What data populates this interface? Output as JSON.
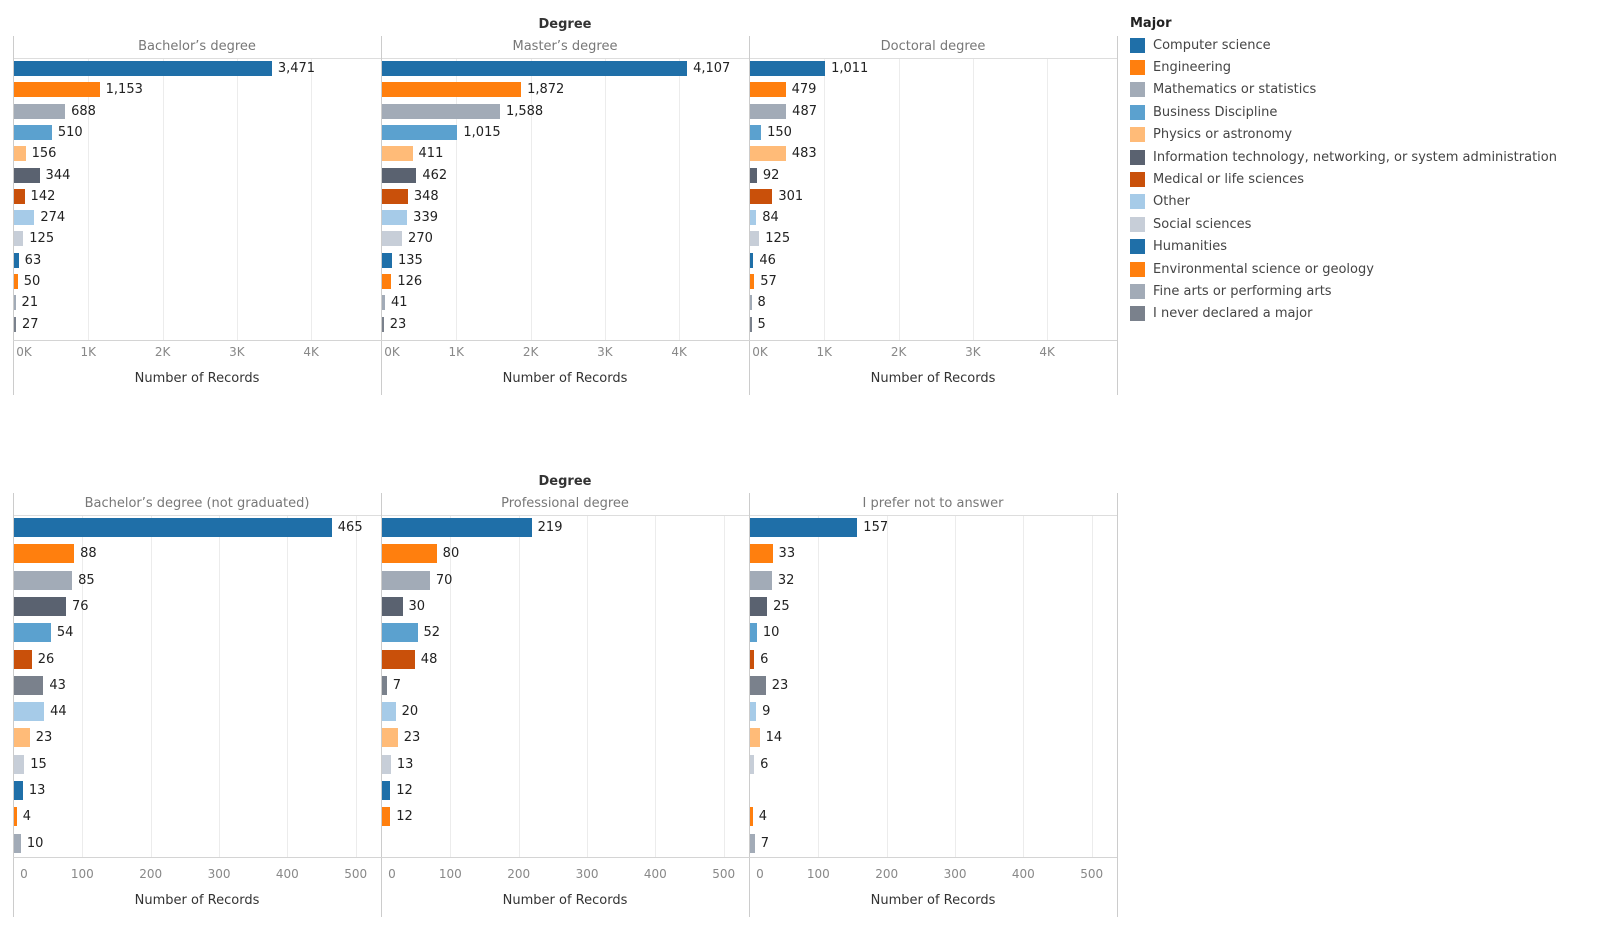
{
  "chart_data": {
    "type": "bar",
    "orientation": "horizontal",
    "facet_title": "Degree",
    "legend": {
      "title": "Major",
      "placement": "right",
      "entries": [
        {
          "name": "Computer science",
          "color": "#1f6fa8"
        },
        {
          "name": "Engineering",
          "color": "#ff7f0e"
        },
        {
          "name": "Mathematics or statistics",
          "color": "#a2abb7"
        },
        {
          "name": "Business Discipline",
          "color": "#5ba1cf"
        },
        {
          "name": "Physics or astronomy",
          "color": "#ffbb78"
        },
        {
          "name": "Information technology, networking, or system administration",
          "color": "#5a6270"
        },
        {
          "name": "Medical or life sciences",
          "color": "#c9500a"
        },
        {
          "name": "Other",
          "color": "#a6cbe8"
        },
        {
          "name": "Social sciences",
          "color": "#c7ced8"
        },
        {
          "name": "Humanities",
          "color": "#1f6fa8"
        },
        {
          "name": "Environmental science or geology",
          "color": "#ff7f0e"
        },
        {
          "name": "Fine arts or performing arts",
          "color": "#a2abb7"
        },
        {
          "name": "I never declared a major",
          "color": "#7a818c"
        }
      ]
    },
    "rows": [
      {
        "title": "Degree",
        "xlabel": "Number of Records",
        "xlim": [
          0,
          4940
        ],
        "ticks": [
          {
            "v": 0,
            "label": "0K"
          },
          {
            "v": 1000,
            "label": "1K"
          },
          {
            "v": 2000,
            "label": "2K"
          },
          {
            "v": 3000,
            "label": "3K"
          },
          {
            "v": 4000,
            "label": "4K"
          }
        ],
        "categories": [
          "Computer science",
          "Engineering",
          "Mathematics or statistics",
          "Business Discipline",
          "Physics or astronomy",
          "Information technology, networking, or system administration",
          "Medical or life sciences",
          "Other",
          "Social sciences",
          "Humanities",
          "Environmental science or geology",
          "Fine arts or performing arts",
          "I never declared a major"
        ],
        "panels": [
          {
            "title": "Bachelor’s degree",
            "values": [
              3471,
              1153,
              688,
              510,
              156,
              344,
              142,
              274,
              125,
              63,
              50,
              21,
              27
            ],
            "labels": [
              "3,471",
              "1,153",
              "688",
              "510",
              "156",
              "344",
              "142",
              "274",
              "125",
              "63",
              "50",
              "21",
              "27"
            ]
          },
          {
            "title": "Master’s degree",
            "values": [
              4107,
              1872,
              1588,
              1015,
              411,
              462,
              348,
              339,
              270,
              135,
              126,
              41,
              23
            ],
            "labels": [
              "4,107",
              "1,872",
              "1,588",
              "1,015",
              "411",
              "462",
              "348",
              "339",
              "270",
              "135",
              "126",
              "41",
              "23"
            ]
          },
          {
            "title": "Doctoral degree",
            "values": [
              1011,
              479,
              487,
              150,
              483,
              92,
              301,
              84,
              125,
              46,
              57,
              8,
              5
            ],
            "labels": [
              "1,011",
              "479",
              "487",
              "150",
              "483",
              "92",
              "301",
              "84",
              "125",
              "46",
              "57",
              "8",
              "5"
            ]
          }
        ]
      },
      {
        "title": "Degree",
        "xlabel": "Number of Records",
        "xlim": [
          0,
          537
        ],
        "ticks": [
          {
            "v": 0,
            "label": "0"
          },
          {
            "v": 100,
            "label": "100"
          },
          {
            "v": 200,
            "label": "200"
          },
          {
            "v": 300,
            "label": "300"
          },
          {
            "v": 400,
            "label": "400"
          },
          {
            "v": 500,
            "label": "500"
          }
        ],
        "categories": [
          "Computer science",
          "Engineering",
          "Mathematics or statistics",
          "Information technology, networking, or system administration",
          "Business Discipline",
          "Medical or life sciences",
          "I never declared a major",
          "Other",
          "Physics or astronomy",
          "Social sciences",
          "Humanities",
          "Environmental science or geology",
          "Fine arts or performing arts"
        ],
        "panels": [
          {
            "title": "Bachelor’s degree (not graduated)",
            "values": [
              465,
              88,
              85,
              76,
              54,
              26,
              43,
              44,
              23,
              15,
              13,
              4,
              10
            ],
            "labels": [
              "465",
              "88",
              "85",
              "76",
              "54",
              "26",
              "43",
              "44",
              "23",
              "15",
              "13",
              "4",
              "10"
            ]
          },
          {
            "title": "Professional degree",
            "values": [
              219,
              80,
              70,
              30,
              52,
              48,
              7,
              20,
              23,
              13,
              12,
              12,
              null
            ],
            "labels": [
              "219",
              "80",
              "70",
              "30",
              "52",
              "48",
              "7",
              "20",
              "23",
              "13",
              "12",
              "12",
              null
            ]
          },
          {
            "title": "I prefer not to answer",
            "values": [
              157,
              33,
              32,
              25,
              10,
              6,
              23,
              9,
              14,
              6,
              null,
              4,
              7
            ],
            "labels": [
              "157",
              "33",
              "32",
              "25",
              "10",
              "6",
              "23",
              "9",
              "14",
              "6",
              null,
              "4",
              "7"
            ]
          }
        ]
      }
    ]
  }
}
